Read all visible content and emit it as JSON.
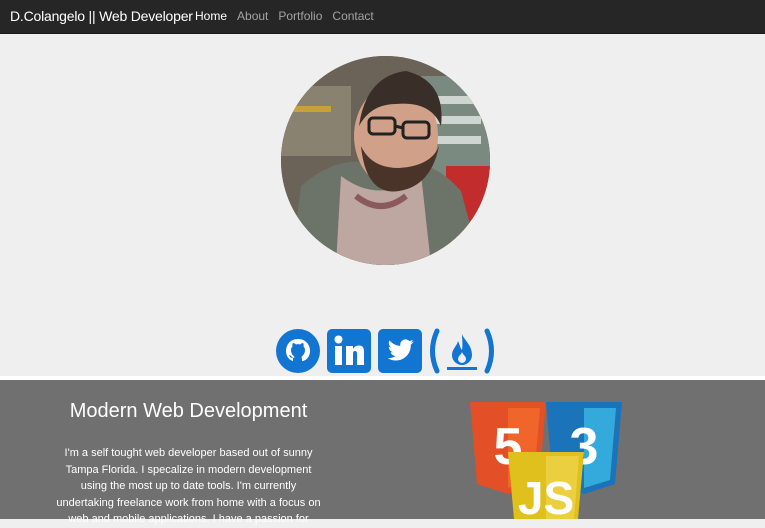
{
  "navbar": {
    "brand": "D.Colangelo || Web Developer",
    "links": [
      {
        "label": "Home",
        "active": true
      },
      {
        "label": "About",
        "active": false
      },
      {
        "label": "Portfolio",
        "active": false
      },
      {
        "label": "Contact",
        "active": false
      }
    ]
  },
  "hero": {
    "avatar_alt": "profile photo",
    "social_icons": [
      "github-icon",
      "linkedin-icon",
      "twitter-icon",
      "freecodecamp-icon"
    ]
  },
  "about": {
    "title": "Modern Web Development",
    "text": "I'm a self tought web developer based out of sunny Tampa Florida. I specalize in modern development using the most up to date tools. I'm currently undertaking freelance work from home with a focus on web and mobile applications. I have a passion for",
    "logos": {
      "html_digit": "5",
      "css_digit": "3",
      "js_label": "JS"
    }
  },
  "colors": {
    "navbar_bg": "#262626",
    "hero_bg": "#efeff0",
    "about_bg": "#707070",
    "social_blue": "#1275d1",
    "html_orange": "#e34f26",
    "css_blue": "#1b73ba",
    "js_yellow": "#e0c01c"
  }
}
